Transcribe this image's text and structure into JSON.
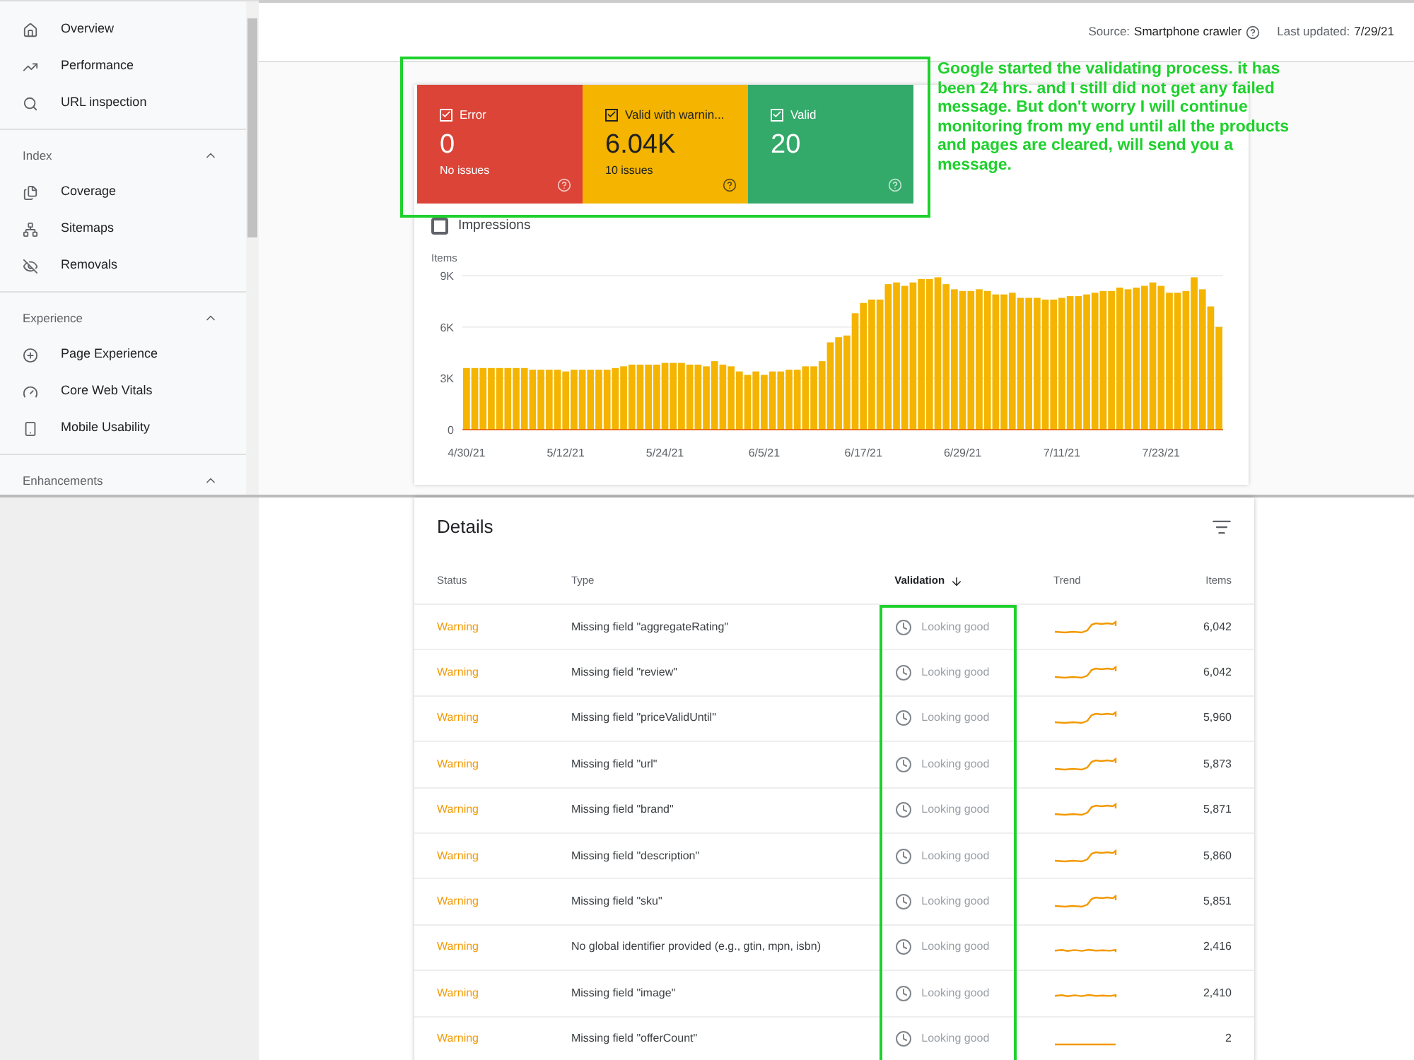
{
  "sidebar": {
    "items": [
      {
        "label": "Overview",
        "selected": false
      },
      {
        "label": "Performance",
        "selected": false
      },
      {
        "label": "URL inspection",
        "selected": false
      }
    ],
    "sections": [
      {
        "title": "Index",
        "expanded": true,
        "items": [
          {
            "label": "Coverage",
            "selected": false
          },
          {
            "label": "Sitemaps",
            "selected": false
          },
          {
            "label": "Removals",
            "selected": false
          }
        ]
      },
      {
        "title": "Experience",
        "expanded": true,
        "items": [
          {
            "label": "Page Experience",
            "selected": false
          },
          {
            "label": "Core Web Vitals",
            "selected": false
          },
          {
            "label": "Mobile Usability",
            "selected": false
          }
        ]
      },
      {
        "title": "Enhancements",
        "expanded": true
      }
    ]
  },
  "header": {
    "source_label": "Source:",
    "source_value": "Smartphone crawler",
    "updated_label": "Last updated:",
    "updated_value": "7/29/21"
  },
  "status_tiles": [
    {
      "kind": "error",
      "label": "Error",
      "checked": true,
      "value": "0",
      "caption": "No issues"
    },
    {
      "kind": "warning",
      "label": "Valid with warnin...",
      "checked": true,
      "value": "6.04K",
      "caption": "10 issues"
    },
    {
      "kind": "valid",
      "label": "Valid",
      "checked": true,
      "value": "20"
    }
  ],
  "impressions": {
    "label": "Impressions",
    "checked": false
  },
  "chart": {
    "chart_data": {
      "type": "bar",
      "ylabel": "Items",
      "ylim": [
        0,
        9000
      ],
      "yticks": [
        {
          "value": 0,
          "label": "0"
        },
        {
          "value": 3000,
          "label": "3K"
        },
        {
          "value": 6000,
          "label": "6K"
        },
        {
          "value": 9000,
          "label": "9K"
        }
      ],
      "categories": [
        "4/30/21",
        null,
        null,
        null,
        null,
        null,
        null,
        null,
        null,
        null,
        null,
        null,
        "5/12/21",
        null,
        null,
        null,
        null,
        null,
        null,
        null,
        null,
        null,
        null,
        null,
        "5/24/21",
        null,
        null,
        null,
        null,
        null,
        null,
        null,
        null,
        null,
        null,
        null,
        "6/5/21",
        null,
        null,
        null,
        null,
        null,
        null,
        null,
        null,
        null,
        null,
        null,
        "6/17/21",
        null,
        null,
        null,
        null,
        null,
        null,
        null,
        null,
        null,
        null,
        null,
        "6/29/21",
        null,
        null,
        null,
        null,
        null,
        null,
        null,
        null,
        null,
        null,
        null,
        "7/11/21",
        null,
        null,
        null,
        null,
        null,
        null,
        null,
        null,
        null,
        null,
        null,
        "7/23/21",
        null,
        null,
        null,
        null,
        null,
        null,
        null
      ],
      "series": [
        {
          "color": "#f4b400",
          "values": [
            3600,
            3600,
            3600,
            3600,
            3600,
            3600,
            3600,
            3600,
            3500,
            3500,
            3500,
            3500,
            3400,
            3500,
            3500,
            3500,
            3500,
            3500,
            3600,
            3700,
            3800,
            3800,
            3800,
            3800,
            3900,
            3900,
            3900,
            3800,
            3800,
            3700,
            4000,
            3800,
            3700,
            3400,
            3200,
            3400,
            3200,
            3400,
            3400,
            3500,
            3500,
            3700,
            3700,
            4000,
            5100,
            5400,
            5500,
            6800,
            7400,
            7600,
            7600,
            8500,
            8600,
            8400,
            8600,
            8800,
            8800,
            8900,
            8500,
            8200,
            8100,
            8100,
            8200,
            8100,
            7900,
            7900,
            8000,
            7700,
            7700,
            7700,
            7600,
            7600,
            7700,
            7800,
            7800,
            7900,
            8000,
            8100,
            8100,
            8300,
            8200,
            8300,
            8400,
            8600,
            8400,
            8000,
            8000,
            8100,
            8900,
            8200,
            7200,
            6000
          ]
        }
      ]
    }
  },
  "annotation": {
    "text": "Google started the validating process. it has been 24 hrs. and I still did not get any failed message. But don't worry I will continue monitoring from my end until all the products and pages are cleared, will send you a message."
  },
  "details": {
    "title": "Details",
    "columns": [
      {
        "label": "Status",
        "sorted": false
      },
      {
        "label": "Type",
        "sorted": false
      },
      {
        "label": "Validation",
        "sorted": true
      },
      {
        "label": "Trend",
        "sorted": false
      },
      {
        "label": "Items",
        "sorted": false
      }
    ],
    "rows": [
      {
        "kind": "rise",
        "status": "Warning",
        "type": "Missing field \"aggregateRating\"",
        "validation": "Looking good",
        "items": "6,042"
      },
      {
        "kind": "rise",
        "status": "Warning",
        "type": "Missing field \"review\"",
        "validation": "Looking good",
        "items": "6,042"
      },
      {
        "kind": "rise",
        "status": "Warning",
        "type": "Missing field \"priceValidUntil\"",
        "validation": "Looking good",
        "items": "5,960"
      },
      {
        "kind": "rise",
        "status": "Warning",
        "type": "Missing field \"url\"",
        "validation": "Looking good",
        "items": "5,873"
      },
      {
        "kind": "rise",
        "status": "Warning",
        "type": "Missing field \"brand\"",
        "validation": "Looking good",
        "items": "5,871"
      },
      {
        "kind": "rise",
        "status": "Warning",
        "type": "Missing field \"description\"",
        "validation": "Looking good",
        "items": "5,860"
      },
      {
        "kind": "rise",
        "status": "Warning",
        "type": "Missing field \"sku\"",
        "validation": "Looking good",
        "items": "5,851"
      },
      {
        "kind": "wavy",
        "status": "Warning",
        "type": "No global identifier provided (e.g., gtin, mpn, isbn)",
        "validation": "Looking good",
        "items": "2,416"
      },
      {
        "kind": "wavy",
        "status": "Warning",
        "type": "Missing field \"image\"",
        "validation": "Looking good",
        "items": "2,410"
      },
      {
        "kind": "flat",
        "status": "Warning",
        "type": "Missing field \"offerCount\"",
        "validation": "Looking good",
        "items": "2"
      }
    ]
  }
}
